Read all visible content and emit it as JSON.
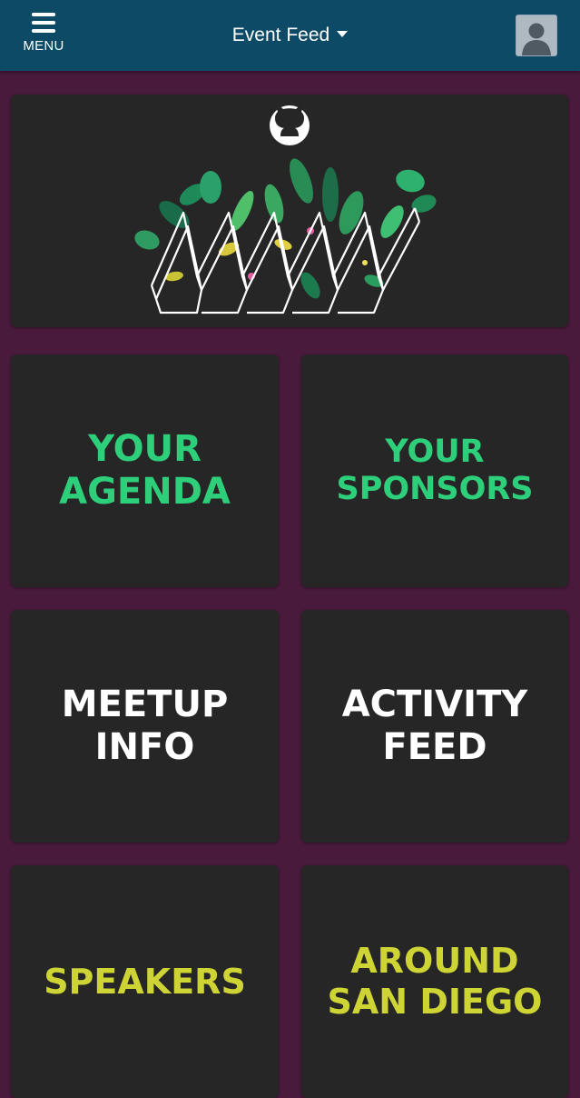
{
  "header": {
    "menu_label": "MENU",
    "title": "Event Feed"
  },
  "hero": {
    "logo": "github-octocat-icon"
  },
  "tiles": [
    {
      "label": "YOUR\nAGENDA",
      "color": "#2ecf7a"
    },
    {
      "label": "YOUR\nSPONSORS",
      "color": "#2ecf7a"
    },
    {
      "label": "MEETUP\nINFO",
      "color": "#ffffff"
    },
    {
      "label": "ACTIVITY\nFEED",
      "color": "#ffffff"
    },
    {
      "label": "SPEAKERS",
      "color": "#cfd435"
    },
    {
      "label": "AROUND\nSAN DIEGO",
      "color": "#cfd435"
    }
  ],
  "colors": {
    "header_bg": "#0c4a66",
    "page_bg": "#4a1a3c",
    "tile_bg": "#262626"
  }
}
